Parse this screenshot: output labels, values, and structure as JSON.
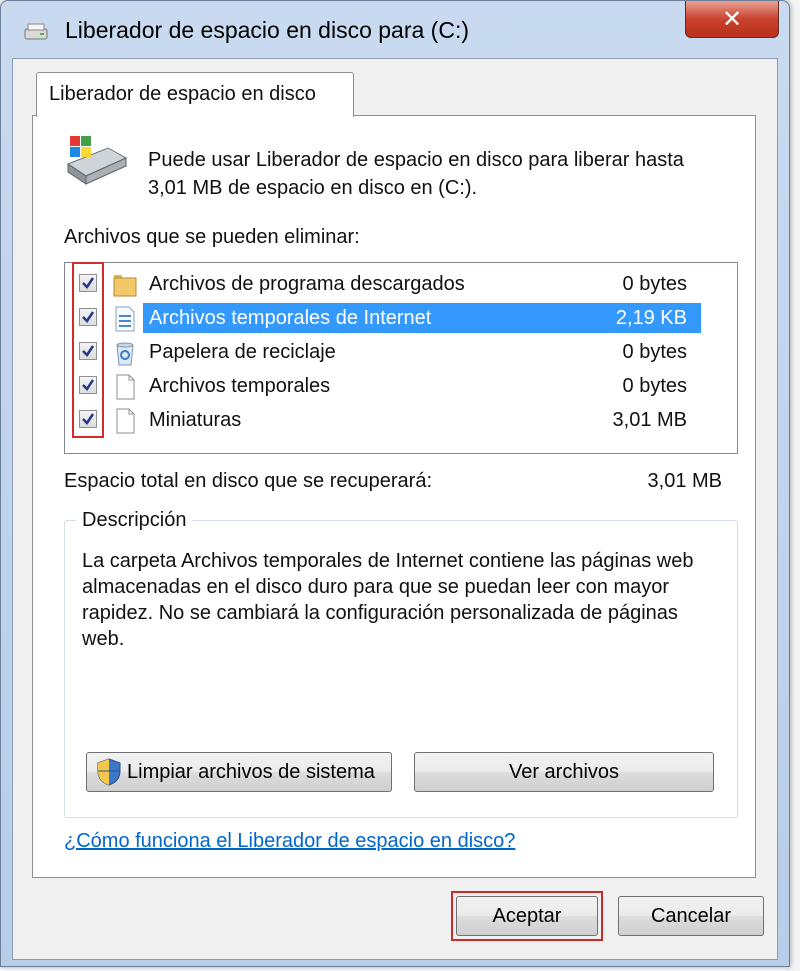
{
  "window": {
    "title": "Liberador de espacio en disco para  (C:)",
    "close_glyph": "✕"
  },
  "tab": {
    "label": "Liberador de espacio en disco"
  },
  "intro": {
    "line1": "Puede usar Liberador de espacio en disco para liberar hasta",
    "line2": "3,01 MB de espacio en disco en  (C:)."
  },
  "files": {
    "label": "Archivos que se pueden eliminar:",
    "items": [
      {
        "name": "Archivos de programa descargados",
        "size": "0 bytes",
        "checked": true,
        "icon": "folder-icon",
        "selected": false
      },
      {
        "name": "Archivos temporales de Internet",
        "size": "2,19 KB",
        "checked": true,
        "icon": "internet-file-icon",
        "selected": true
      },
      {
        "name": "Papelera de reciclaje",
        "size": "0 bytes",
        "checked": true,
        "icon": "recycle-bin-icon",
        "selected": false
      },
      {
        "name": "Archivos temporales",
        "size": "0 bytes",
        "checked": true,
        "icon": "file-icon",
        "selected": false
      },
      {
        "name": "Miniaturas",
        "size": "3,01 MB",
        "checked": true,
        "icon": "file-icon",
        "selected": false
      }
    ]
  },
  "total": {
    "label": "Espacio total en disco que se recuperará:",
    "value": "3,01 MB"
  },
  "description": {
    "title": "Descripción",
    "text": "La carpeta Archivos temporales de Internet contiene las páginas web almacenadas en el disco duro para que se puedan leer con mayor rapidez. No se cambiará la configuración personalizada de páginas web."
  },
  "buttons": {
    "clean_system": "Limpiar archivos de sistema",
    "view_files": "Ver archivos",
    "ok": "Aceptar",
    "cancel": "Cancelar"
  },
  "help_link": "¿Cómo funciona el Liberador de espacio en disco?",
  "colors": {
    "selection": "#3399ff",
    "highlight_border": "#d32a2a",
    "link": "#0066cc"
  }
}
